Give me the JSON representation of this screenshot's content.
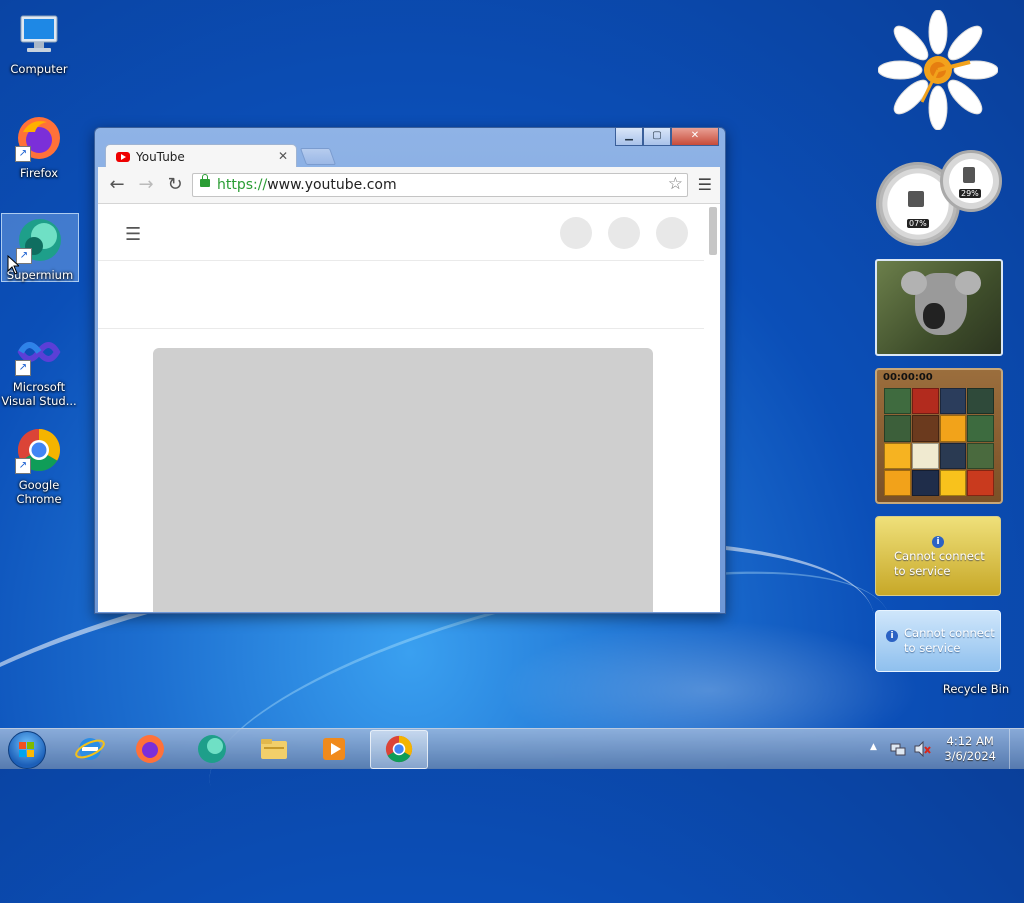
{
  "desktop": {
    "icons": [
      {
        "label": "Computer"
      },
      {
        "label": "Firefox"
      },
      {
        "label": "Supermium"
      },
      {
        "label": "Microsoft Visual Stud..."
      },
      {
        "label": "Google Chrome"
      },
      {
        "label": "Recycle Bin"
      }
    ]
  },
  "browser": {
    "tab_title": "YouTube",
    "tab_close": "✕",
    "url_scheme": "https://",
    "url_host": "www.youtube.com",
    "controls": {
      "minimize": "▁",
      "maximize": "▢",
      "close": "✕"
    }
  },
  "gadgets": {
    "cpu_gauge": "07%",
    "memory_gauge": "29%",
    "puzzle_timer": "00:00:00",
    "weather_message": "Cannot connect to service",
    "feed_message": "Cannot connect to service"
  },
  "taskbar": {
    "time": "4:12 AM",
    "date": "3/6/2024"
  },
  "colors": {
    "accent": "#1d6fd0",
    "secure_green": "#2a9d34",
    "youtube_red": "#e00000"
  }
}
